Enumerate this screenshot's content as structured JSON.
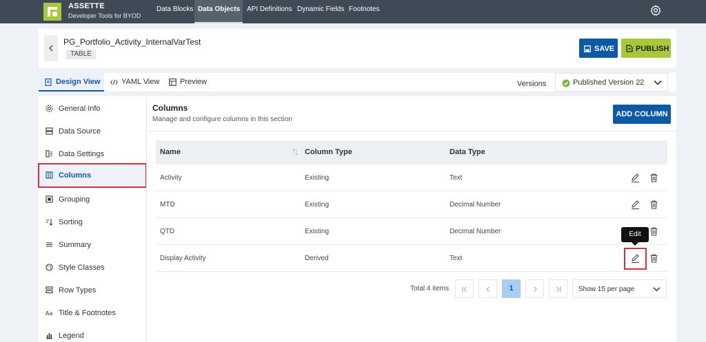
{
  "app": {
    "brand_name": "ASSETTE",
    "brand_subtitle": "Developer Tools for BYOD",
    "nav": [
      "Data Blocks",
      "Data Objects",
      "API Definitions",
      "Dynamic Fields",
      "Footnotes"
    ],
    "active_nav": "Data Objects"
  },
  "header": {
    "title": "PG_Portfolio_Activity_InternalVarTest",
    "badge": "TABLE",
    "save_label": "SAVE",
    "publish_label": "PUBLISH"
  },
  "view_tabs": {
    "tabs": [
      "Design View",
      "YAML View",
      "Preview"
    ],
    "active": "Design View",
    "versions_label": "Versions",
    "selected_version": "Published Version 22"
  },
  "sidebar": {
    "items": [
      "General Info",
      "Data Source",
      "Data Settings",
      "Columns",
      "Grouping",
      "Sorting",
      "Summary",
      "Style Classes",
      "Row Types",
      "Title & Footnotes",
      "Legend"
    ],
    "active": "Columns"
  },
  "columns_section": {
    "title": "Columns",
    "subtitle": "Manage and configure columns in this section",
    "add_label": "ADD COLUMN",
    "headers": [
      "Name",
      "Column Type",
      "Data Type"
    ],
    "rows": [
      {
        "name": "Activity",
        "column_type": "Existing",
        "data_type": "Text"
      },
      {
        "name": "MTD",
        "column_type": "Existing",
        "data_type": "Decimal Number"
      },
      {
        "name": "QTD",
        "column_type": "Existing",
        "data_type": "Decimal Number"
      },
      {
        "name": "Display Activity",
        "column_type": "Derived",
        "data_type": "Text"
      }
    ],
    "tooltip": "Edit"
  },
  "pagination": {
    "total_label": "Total 4 items",
    "current_page": "1",
    "per_page": "Show 15 per page"
  },
  "colors": {
    "primary": "#0c5aa6",
    "accent": "#a8c83a",
    "nav_bg": "#3f4a56",
    "highlight": "#d0303a"
  }
}
